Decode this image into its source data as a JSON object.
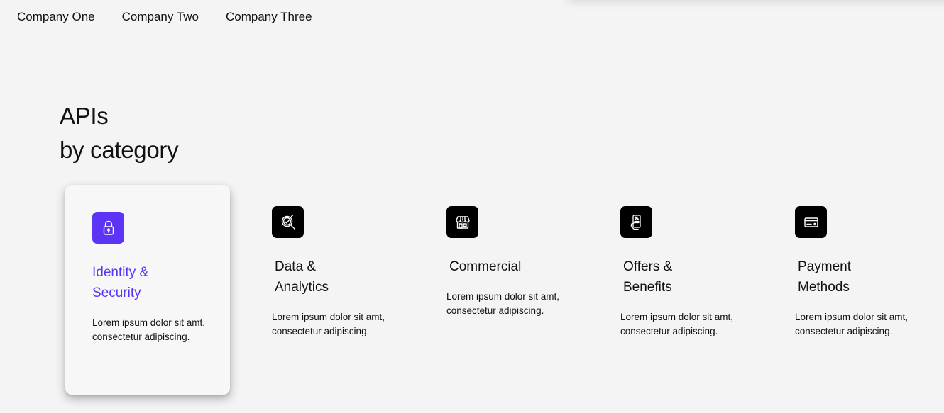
{
  "nav": {
    "items": [
      {
        "label": "Company One"
      },
      {
        "label": "Company Two"
      },
      {
        "label": "Company Three"
      }
    ]
  },
  "heading": {
    "line1": "APIs",
    "line2": "by category"
  },
  "colors": {
    "accent": "#5b34f5",
    "icon_bg": "#000000",
    "background": "#f4f4f4"
  },
  "categories": [
    {
      "title_line1": "Identity &",
      "title_line2": "Security",
      "description_line1": "Lorem ipsum dolor sit amt,",
      "description_line2": "consectetur adipiscing.",
      "icon": "lock-icon",
      "active": true
    },
    {
      "title_line1": "Data &",
      "title_line2": "Analytics",
      "description_line1": "Lorem ipsum dolor sit amt,",
      "description_line2": "consectetur adipiscing.",
      "icon": "analytics-search-icon",
      "active": false
    },
    {
      "title_line1": "Commercial",
      "title_line2": "",
      "description_line1": "Lorem ipsum dolor sit amt,",
      "description_line2": "consectetur adipiscing.",
      "icon": "storefront-icon",
      "active": false
    },
    {
      "title_line1": "Offers &",
      "title_line2": "Benefits",
      "description_line1": "Lorem ipsum dolor sit amt,",
      "description_line2": "consectetur adipiscing.",
      "icon": "mobile-offer-icon",
      "active": false
    },
    {
      "title_line1": "Payment",
      "title_line2": "Methods",
      "description_line1": "Lorem ipsum dolor sit amt,",
      "description_line2": "consectetur adipiscing.",
      "icon": "credit-card-icon",
      "active": false
    }
  ]
}
